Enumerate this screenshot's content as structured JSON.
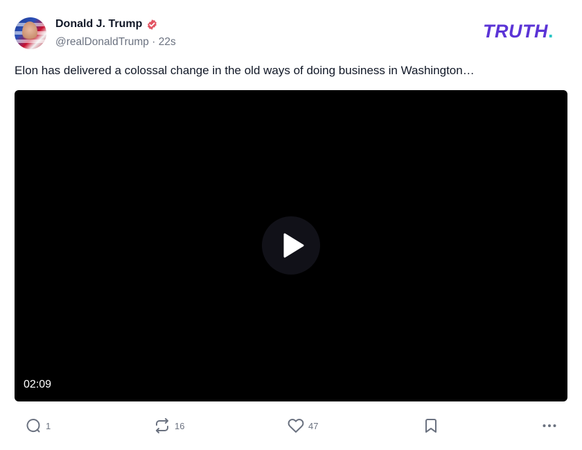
{
  "author": {
    "display_name": "Donald J. Trump",
    "handle": "@realDonaldTrump",
    "separator": "·",
    "time_ago": "22s",
    "verified_color": "#e25563"
  },
  "brand": {
    "logo_text": "TRUTH",
    "logo_dot": ".",
    "logo_color": "#5b34d6",
    "dot_color": "#2cc6c6"
  },
  "post": {
    "text": "Elon has delivered a colossal change in the old ways of doing business in Washington…"
  },
  "video": {
    "duration": "02:09",
    "play_icon": "play-icon"
  },
  "actions": {
    "reply_count": "1",
    "retruth_count": "16",
    "like_count": "47",
    "icons": [
      "reply-icon",
      "retruth-icon",
      "heart-icon",
      "bookmark-icon",
      "more-icon"
    ]
  }
}
